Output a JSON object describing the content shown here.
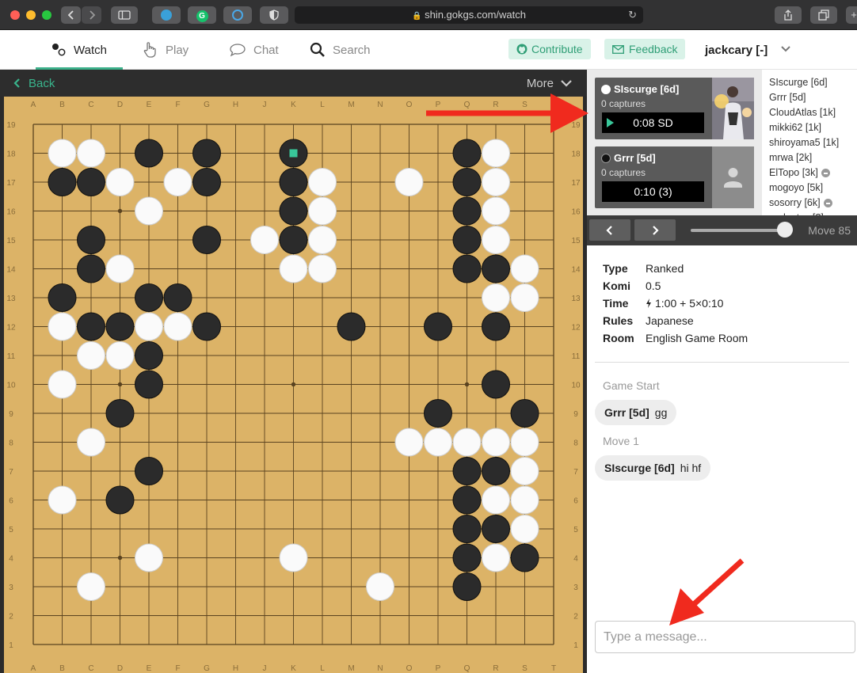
{
  "browser": {
    "url": "shin.gokgs.com/watch",
    "lock_icon": "lock-icon"
  },
  "nav": {
    "tabs": [
      {
        "label": "Watch",
        "icon": "stones-icon",
        "active": true
      },
      {
        "label": "Play",
        "icon": "hand-pointer-icon"
      },
      {
        "label": "Chat",
        "icon": "speech-bubble-icon"
      },
      {
        "label": "Search",
        "icon": "search-icon"
      }
    ],
    "contribute": "Contribute",
    "feedback": "Feedback",
    "username": "jackcary [-]"
  },
  "board": {
    "back_label": "Back",
    "more_label": "More",
    "columns": [
      "A",
      "B",
      "C",
      "D",
      "E",
      "F",
      "G",
      "H",
      "J",
      "K",
      "L",
      "M",
      "N",
      "O",
      "P",
      "Q",
      "R",
      "S",
      "T"
    ],
    "rows": [
      "19",
      "18",
      "17",
      "16",
      "15",
      "14",
      "13",
      "12",
      "11",
      "10",
      "9",
      "8",
      "7",
      "6",
      "5",
      "4",
      "3",
      "2",
      "1"
    ],
    "last_move": "K18",
    "black_stones": [
      "E18",
      "G18",
      "K18",
      "Q18",
      "B17",
      "C17",
      "G17",
      "K17",
      "Q17",
      "K16",
      "Q16",
      "C15",
      "G15",
      "K15",
      "Q15",
      "C14",
      "Q14",
      "R14",
      "B13",
      "E13",
      "F13",
      "C12",
      "D12",
      "G12",
      "M12",
      "P12",
      "R12",
      "E11",
      "E10",
      "R10",
      "D9",
      "P9",
      "S9",
      "E7",
      "Q7",
      "R7",
      "D6",
      "Q6",
      "Q5",
      "R5",
      "Q4",
      "S4",
      "Q3"
    ],
    "white_stones": [
      "B18",
      "C18",
      "R18",
      "D17",
      "F17",
      "L17",
      "O17",
      "R17",
      "E16",
      "L16",
      "R16",
      "J15",
      "L15",
      "R15",
      "D14",
      "K14",
      "L14",
      "S14",
      "R13",
      "S13",
      "B12",
      "E12",
      "F12",
      "C11",
      "D11",
      "B10",
      "C8",
      "O8",
      "P8",
      "Q8",
      "R8",
      "S8",
      "S7",
      "B6",
      "R6",
      "S6",
      "S5",
      "E4",
      "K4",
      "R4",
      "C3",
      "N3"
    ],
    "star_points": [
      "D16",
      "K16",
      "Q16",
      "D10",
      "K10",
      "Q10",
      "D4",
      "K4",
      "Q4"
    ]
  },
  "players": {
    "white": {
      "name": "SIscurge [6d]",
      "captures": "0 captures",
      "clock": "0:08 SD",
      "stone": "white"
    },
    "black": {
      "name": "Grrr [5d]",
      "captures": "0 captures",
      "clock": "0:10 (3)",
      "stone": "black"
    }
  },
  "spectators": [
    {
      "name": "SIscurge [6d]"
    },
    {
      "name": "Grrr [5d]"
    },
    {
      "name": "CloudAtlas [1k]"
    },
    {
      "name": "mikki62 [1k]"
    },
    {
      "name": "shiroyama5 [1k]"
    },
    {
      "name": "mrwa [2k]"
    },
    {
      "name": "ElTopo [3k]",
      "badge": "minus-circle-icon"
    },
    {
      "name": "mogoyo [5k]"
    },
    {
      "name": "sosorry [6k]",
      "badge": "minus-circle-icon"
    },
    {
      "name": "andantes [?]"
    }
  ],
  "moves": {
    "label": "Move 85",
    "current": 85
  },
  "game_info": {
    "type_label": "Type",
    "type": "Ranked",
    "komi_label": "Komi",
    "komi": "0.5",
    "time_label": "Time",
    "time": "1:00 + 5×0:10",
    "rules_label": "Rules",
    "rules": "Japanese",
    "room_label": "Room",
    "room": "English Game Room"
  },
  "chat": {
    "game_start": "Game Start",
    "msg1_author": "Grrr [5d]",
    "msg1_text": "gg",
    "move_marker": "Move 1",
    "msg2_author": "SIscurge [6d]",
    "msg2_text": "hi hf",
    "input_placeholder": "Type a message..."
  },
  "colors": {
    "accent": "#39b48c",
    "board": "#dcb367",
    "annotation_arrow": "#f02a1e"
  }
}
